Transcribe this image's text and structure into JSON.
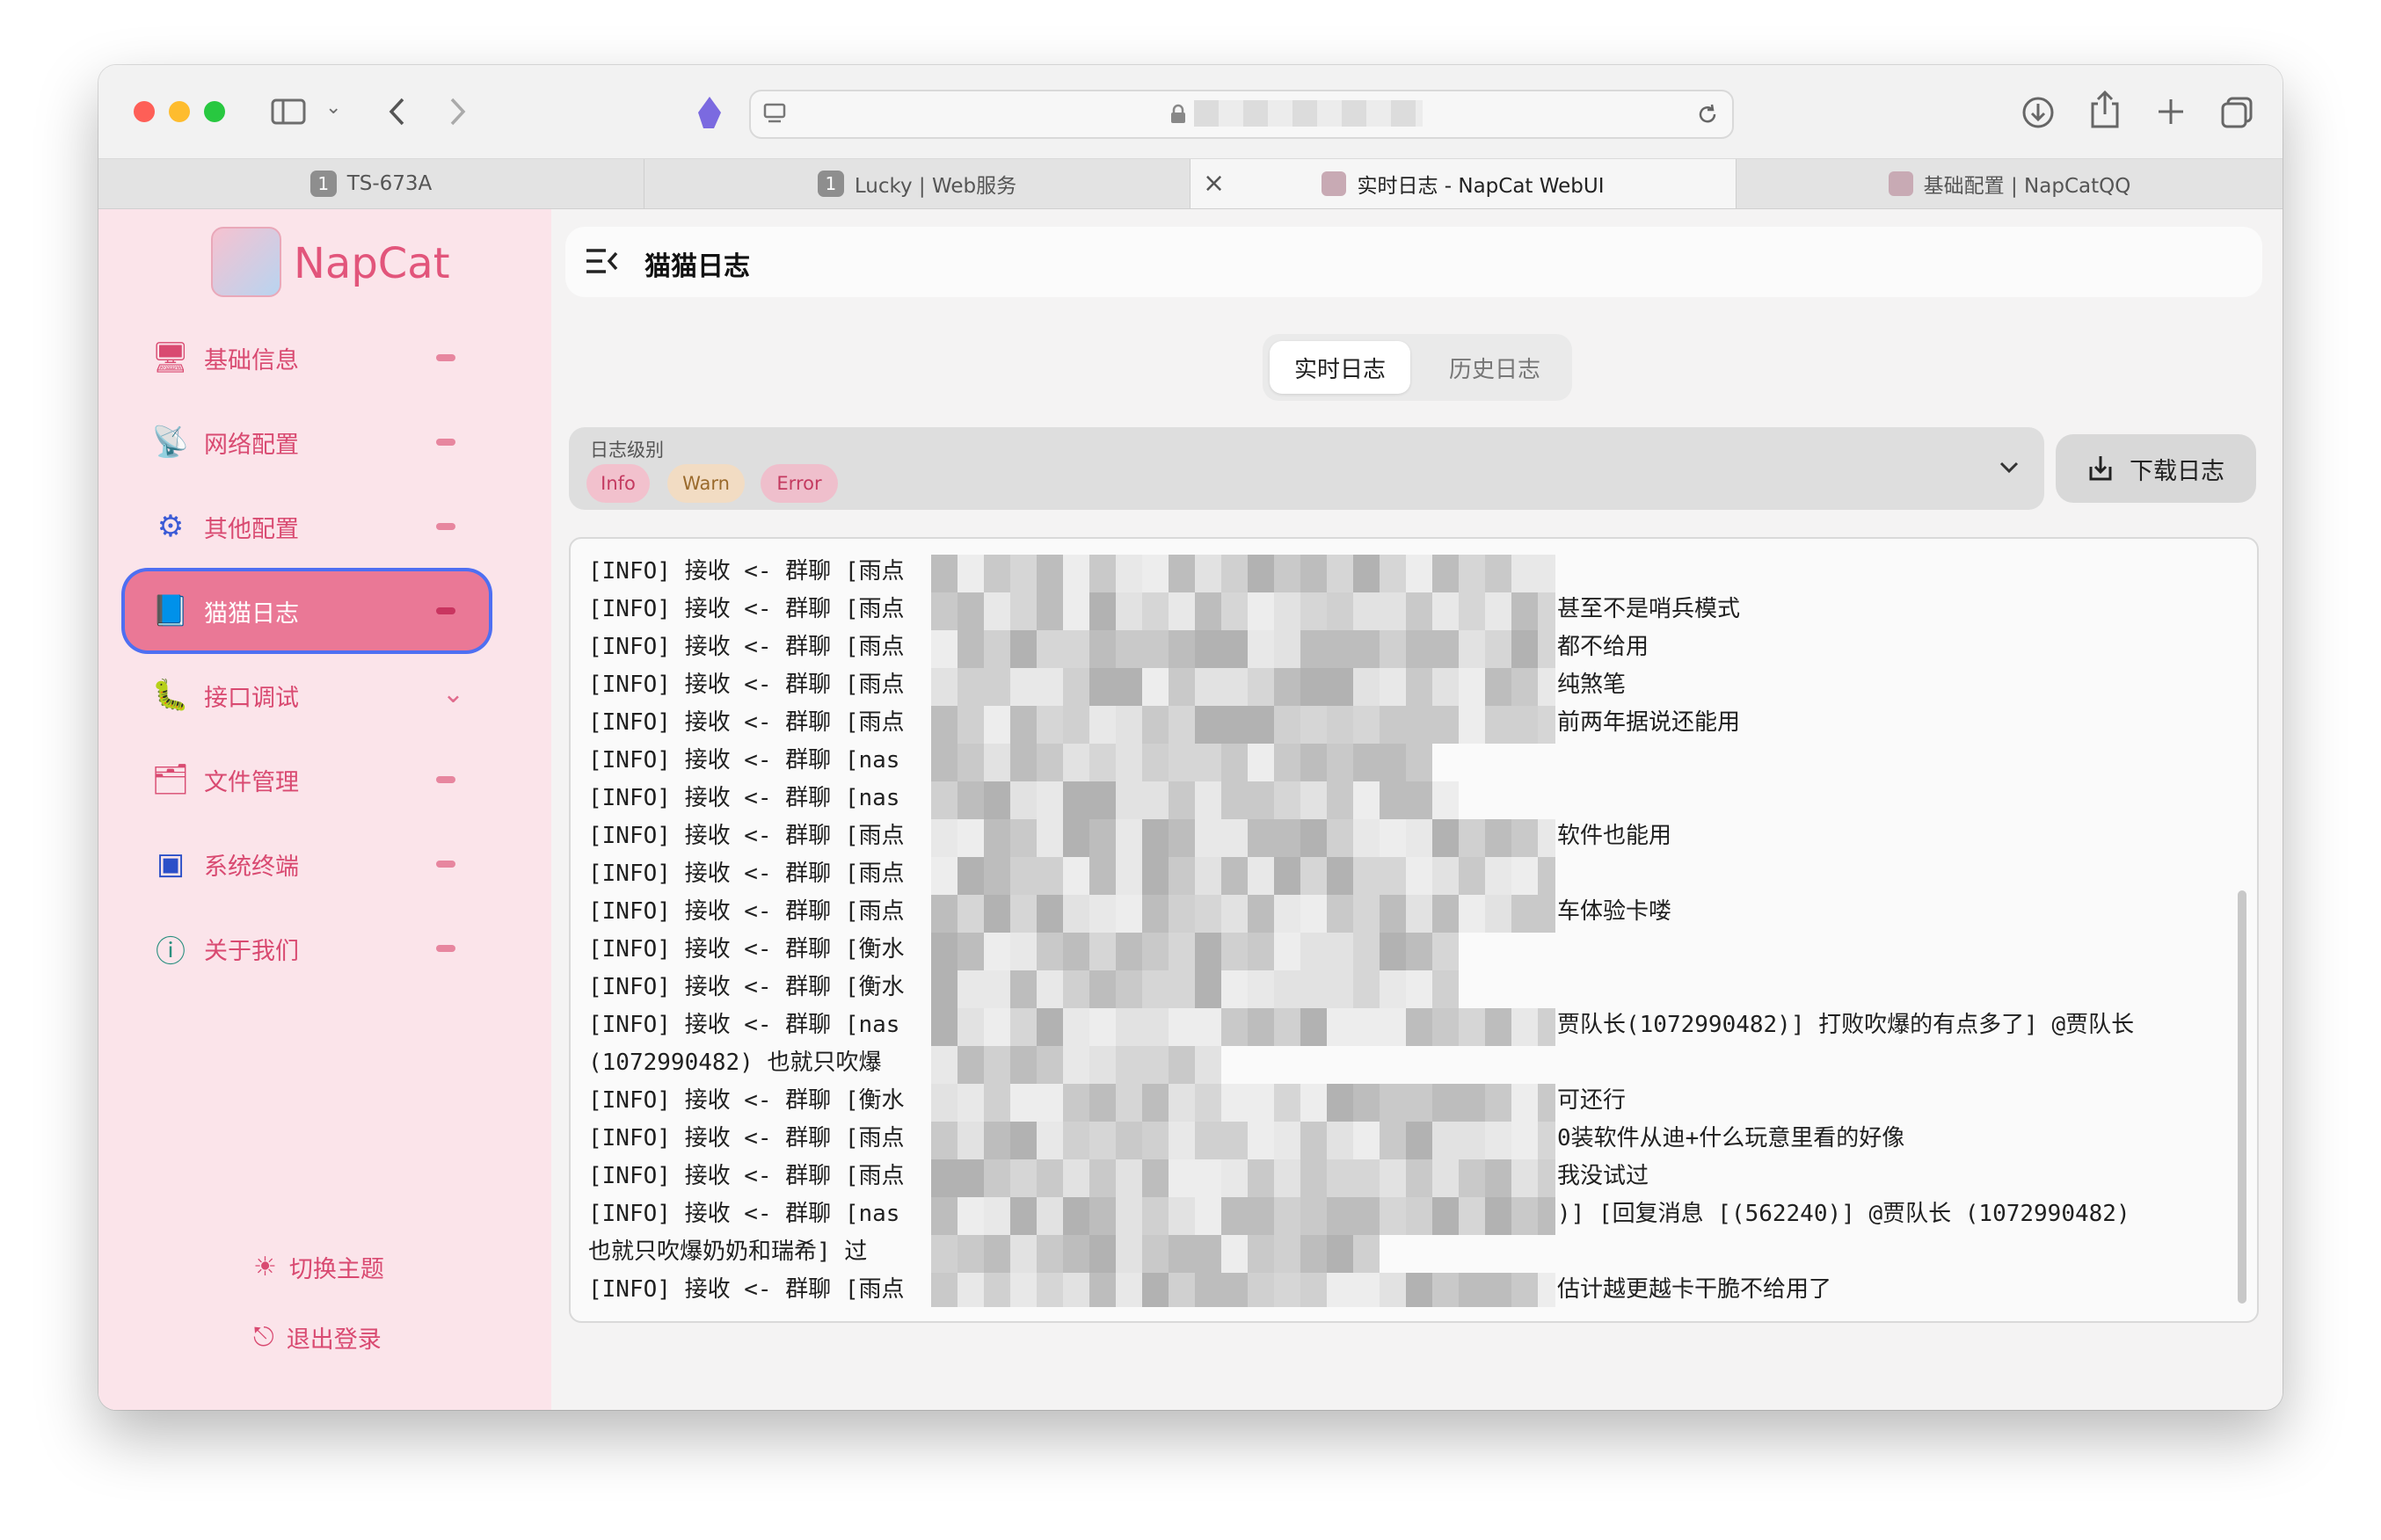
{
  "browser": {
    "address": "",
    "tabs": [
      {
        "num": "1",
        "label": "TS-673A"
      },
      {
        "num": "1",
        "label": "Lucky | Web服务"
      },
      {
        "label": "实时日志 - NapCat WebUI",
        "close": "×"
      },
      {
        "label": "基础配置 | NapCatQQ"
      }
    ]
  },
  "sidebar": {
    "brand": "NapCat",
    "items": [
      {
        "label": "基础信息",
        "icon": "gear-screen-icon"
      },
      {
        "label": "网络配置",
        "icon": "antenna-icon"
      },
      {
        "label": "其他配置",
        "icon": "cog-icon"
      },
      {
        "label": "猫猫日志",
        "icon": "log-book-icon"
      },
      {
        "label": "接口调试",
        "icon": "bug-icon"
      },
      {
        "label": "文件管理",
        "icon": "folder-icon"
      },
      {
        "label": "系统终端",
        "icon": "terminal-icon"
      },
      {
        "label": "关于我们",
        "icon": "info-icon"
      }
    ],
    "theme_toggle": "切换主题",
    "logout": "退出登录"
  },
  "header": {
    "title": "猫猫日志"
  },
  "segment": {
    "realtime": "实时日志",
    "history": "历史日志"
  },
  "filter": {
    "label": "日志级别",
    "chips": [
      "Info",
      "Warn",
      "Error"
    ]
  },
  "download_label": "下载日志",
  "log": {
    "lines": [
      {
        "left": "[INFO] 接收 <- 群聊 [雨点",
        "right": ""
      },
      {
        "left": "[INFO] 接收 <- 群聊 [雨点",
        "right": "甚至不是哨兵模式"
      },
      {
        "left": "[INFO] 接收 <- 群聊 [雨点",
        "right": "都不给用"
      },
      {
        "left": "[INFO] 接收 <- 群聊 [雨点",
        "right": "纯煞笔"
      },
      {
        "left": "[INFO] 接收 <- 群聊 [雨点",
        "right": "前两年据说还能用"
      },
      {
        "left": "[INFO] 接收 <- 群聊 [nas",
        "right": ""
      },
      {
        "left": "[INFO] 接收 <- 群聊 [nas",
        "right": ""
      },
      {
        "left": "[INFO] 接收 <- 群聊 [雨点",
        "right": "软件也能用"
      },
      {
        "left": "[INFO] 接收 <- 群聊 [雨点",
        "right": ""
      },
      {
        "left": "[INFO] 接收 <- 群聊 [雨点",
        "right": "车体验卡喽"
      },
      {
        "left": "[INFO] 接收 <- 群聊 [衡水",
        "right": ""
      },
      {
        "left": "[INFO] 接收 <- 群聊 [衡水",
        "right": ""
      },
      {
        "left": "[INFO] 接收 <- 群聊 [nas",
        "right": "贾队长(1072990482)] 打败吹爆的有点多了] @贾队长"
      },
      {
        "left": "(1072990482) 也就只吹爆",
        "right": ""
      },
      {
        "left": "[INFO] 接收 <- 群聊 [衡水",
        "right": "可还行"
      },
      {
        "left": "[INFO] 接收 <- 群聊 [雨点",
        "right": "0装软件从迪+什么玩意里看的好像"
      },
      {
        "left": "[INFO] 接收 <- 群聊 [雨点",
        "right": "我没试过"
      },
      {
        "left": "[INFO] 接收 <- 群聊 [nas",
        "right": ")] [回复消息 [(562240)] @贾队长 (1072990482)"
      },
      {
        "left": "也就只吹爆奶奶和瑞希] 过",
        "right": ""
      },
      {
        "left": "[INFO] 接收 <- 群聊 [雨点",
        "right": "估计越更越卡干脆不给用了"
      }
    ]
  },
  "colors": {
    "accent": "#ea7896",
    "brand_text": "#e2557b",
    "sidebar_bg": "#fbe4ea",
    "focus_ring": "#4e6ff2"
  }
}
